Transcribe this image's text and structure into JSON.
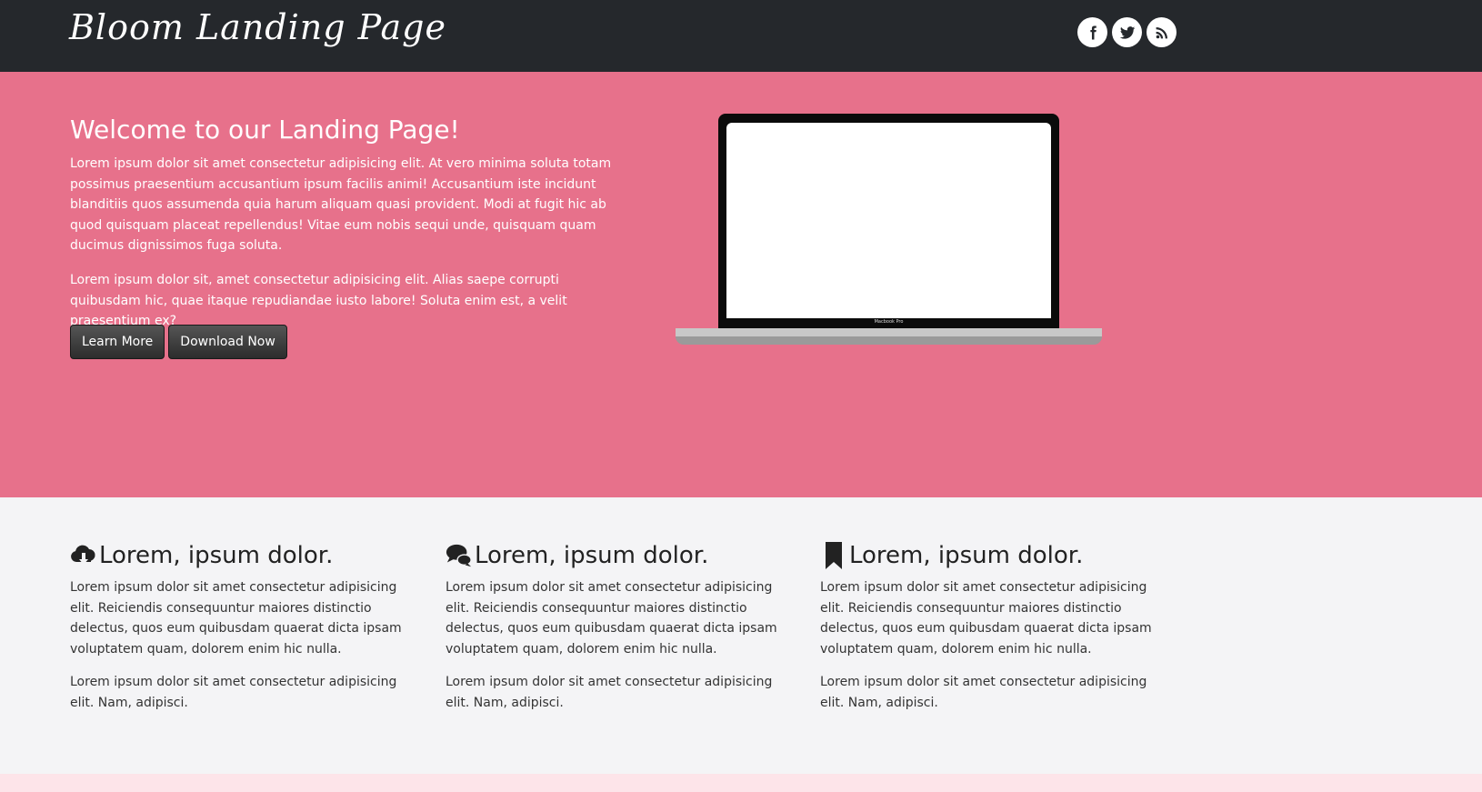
{
  "header": {
    "brand": "Bloom Landing Page",
    "social": [
      "facebook-icon",
      "twitter-icon",
      "rss-icon"
    ]
  },
  "hero": {
    "title": "Welcome to our Landing Page!",
    "paragraph1": "Lorem ipsum dolor sit amet consectetur adipisicing elit. At vero minima soluta totam possimus praesentium accusantium ipsum facilis animi! Accusantium iste incidunt blanditiis quos assumenda quia harum aliquam quasi provident. Modi at fugit hic ab quod quisquam placeat repellendus! Vitae eum nobis sequi unde, quisquam quam ducimus dignissimos fuga soluta.",
    "paragraph2": "Lorem ipsum dolor sit, amet consectetur adipisicing elit. Alias saepe corrupti quibusdam hic, quae itaque repudiandae iusto labore! Soluta enim est, a velit praesentium ex?",
    "learn_more": "Learn More",
    "download_now": "Download Now",
    "laptop_label": "Macbook Pro"
  },
  "features": [
    {
      "icon": "cloud-download-icon",
      "title": "Lorem, ipsum dolor.",
      "p1": "Lorem ipsum dolor sit amet consectetur adipisicing elit. Reiciendis consequuntur maiores distinctio delectus, quos eum quibusdam quaerat dicta ipsam voluptatem quam, dolorem enim hic nulla.",
      "p2": "Lorem ipsum dolor sit amet consectetur adipisicing elit. Nam, adipisci."
    },
    {
      "icon": "chat-bubbles-icon",
      "title": "Lorem, ipsum dolor.",
      "p1": "Lorem ipsum dolor sit amet consectetur adipisicing elit. Reiciendis consequuntur maiores distinctio delectus, quos eum quibusdam quaerat dicta ipsam voluptatem quam, dolorem enim hic nulla.",
      "p2": "Lorem ipsum dolor sit amet consectetur adipisicing elit. Nam, adipisci."
    },
    {
      "icon": "bookmark-icon",
      "title": "Lorem, ipsum dolor.",
      "p1": "Lorem ipsum dolor sit amet consectetur adipisicing elit. Reiciendis consequuntur maiores distinctio delectus, quos eum quibusdam quaerat dicta ipsam voluptatem quam, dolorem enim hic nulla.",
      "p2": "Lorem ipsum dolor sit amet consectetur adipisicing elit. Nam, adipisci."
    }
  ],
  "colors": {
    "header_bg": "#25282c",
    "hero_bg": "#e7718b",
    "features_bg": "#f4f4f6",
    "footer_strip": "#fde4e9"
  }
}
